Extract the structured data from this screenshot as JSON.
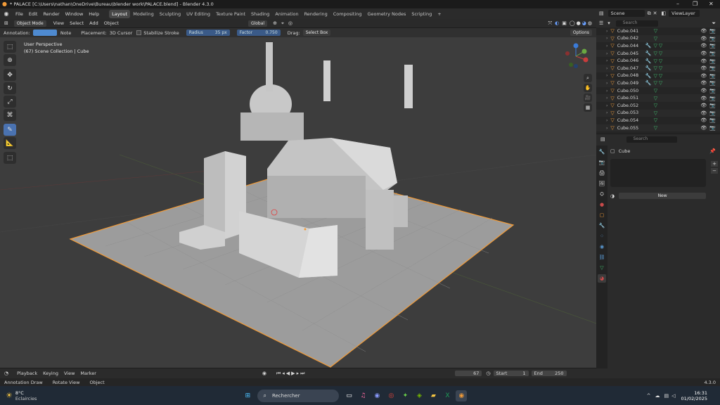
{
  "title_bar": {
    "title": "* PALACE [C:\\Users\\nathan\\OneDrive\\Bureau\\blender work\\PALACE.blend] - Blender 4.3.0"
  },
  "menu": [
    "File",
    "Edit",
    "Render",
    "Window",
    "Help"
  ],
  "workspaces": [
    "Layout",
    "Modeling",
    "Sculpting",
    "UV Editing",
    "Texture Paint",
    "Shading",
    "Animation",
    "Rendering",
    "Compositing",
    "Geometry Nodes",
    "Scripting"
  ],
  "active_workspace": "Layout",
  "scene": {
    "label": "Scene",
    "view_layer": "ViewLayer"
  },
  "viewport_header": {
    "mode": "Object Mode",
    "menus": [
      "View",
      "Select",
      "Add",
      "Object"
    ],
    "orientation": "Global"
  },
  "tool_options": {
    "annotation_label": "Annotation:",
    "note": "Note",
    "placement_label": "Placement:",
    "placement": "3D Cursor",
    "stabilize": "Stabilize Stroke",
    "radius_label": "Radius",
    "radius": "35 px",
    "factor_label": "Factor",
    "factor": "0.750",
    "drag_label": "Drag:",
    "drag": "Select Box",
    "options": "Options"
  },
  "viewport": {
    "perspective": "User Perspective",
    "collection": "(67) Scene Collection | Cube"
  },
  "outliner": {
    "search_placeholder": "Search",
    "items": [
      "Cube.041",
      "Cube.042",
      "Cube.044",
      "Cube.045",
      "Cube.046",
      "Cube.047",
      "Cube.048",
      "Cube.049",
      "Cube.050",
      "Cube.051",
      "Cube.052",
      "Cube.053",
      "Cube.054",
      "Cube.055"
    ]
  },
  "properties": {
    "search_placeholder": "Search",
    "object_name": "Cube",
    "new_button": "New"
  },
  "timeline": {
    "menus": [
      "Playback",
      "Keying",
      "View",
      "Marker"
    ],
    "current_frame": "67",
    "start_label": "Start",
    "start": "1",
    "end_label": "End",
    "end": "250"
  },
  "statusbar": {
    "items": [
      "Annotation Draw",
      "Rotate View",
      "Object"
    ],
    "version": "4.3.0"
  },
  "taskbar": {
    "weather_temp": "8°C",
    "weather_desc": "Eclaircies",
    "search": "Rechercher",
    "time": "16:31",
    "date": "01/02/2025"
  },
  "colors": {
    "accent": "#4a72b0",
    "selection": "#f29b38",
    "viewport_bg": "#3d3d3d"
  }
}
